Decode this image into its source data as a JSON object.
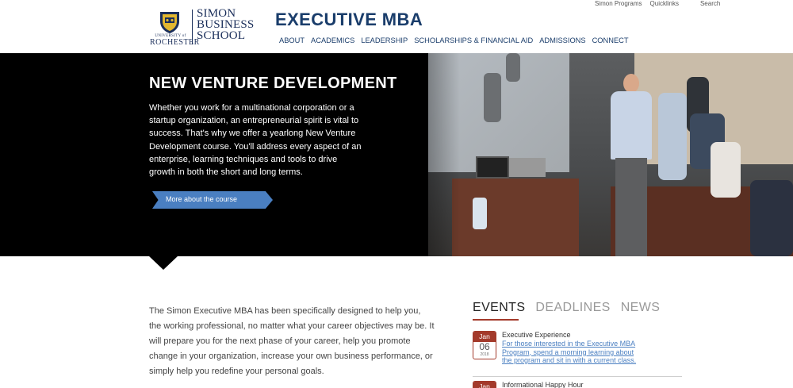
{
  "utility": {
    "simon_programs": "Simon Programs",
    "quicklinks": "Quicklinks",
    "search": "Search"
  },
  "logo": {
    "university_small": "UNIVERSITY of",
    "university_big": "ROCHESTER",
    "school_line1": "SIMON",
    "school_line2": "BUSINESS",
    "school_line3": "SCHOOL"
  },
  "site_title": "EXECUTIVE MBA",
  "nav": [
    {
      "label": "ABOUT"
    },
    {
      "label": "ACADEMICS"
    },
    {
      "label": "LEADERSHIP"
    },
    {
      "label": "SCHOLARSHIPS & FINANCIAL AID"
    },
    {
      "label": "ADMISSIONS"
    },
    {
      "label": "CONNECT"
    }
  ],
  "hero": {
    "title": "NEW VENTURE DEVELOPMENT",
    "text": "Whether you work for a multinational corporation or a startup organization, an entrepreneurial spirit is vital to success. That's why we offer a yearlong New Venture Development course. You'll address every aspect of an enterprise, learning techniques and tools to drive growth in both the short and long terms.",
    "button_label": "More about the course"
  },
  "intro": "The Simon Executive MBA has been specifically designed to help you, the working professional, no matter what your career objectives may be. It will prepare you for the next phase of your career, help you promote change in your organization, increase your own business performance, or simply help you redefine your personal goals.",
  "tabs": [
    {
      "label": "EVENTS"
    },
    {
      "label": "DEADLINES"
    },
    {
      "label": "NEWS"
    }
  ],
  "events": [
    {
      "month": "Jan",
      "day": "06",
      "year": "2018",
      "title": "Executive Experience",
      "description": "For those interested in the Executive MBA Program, spend a morning learning about the program and sit in with a current class."
    },
    {
      "month": "Jan",
      "title": "Informational Happy Hour"
    }
  ],
  "colors": {
    "navy": "#1a3d6b",
    "accent_red": "#a33a2b",
    "button_blue": "#4a7fc1"
  }
}
